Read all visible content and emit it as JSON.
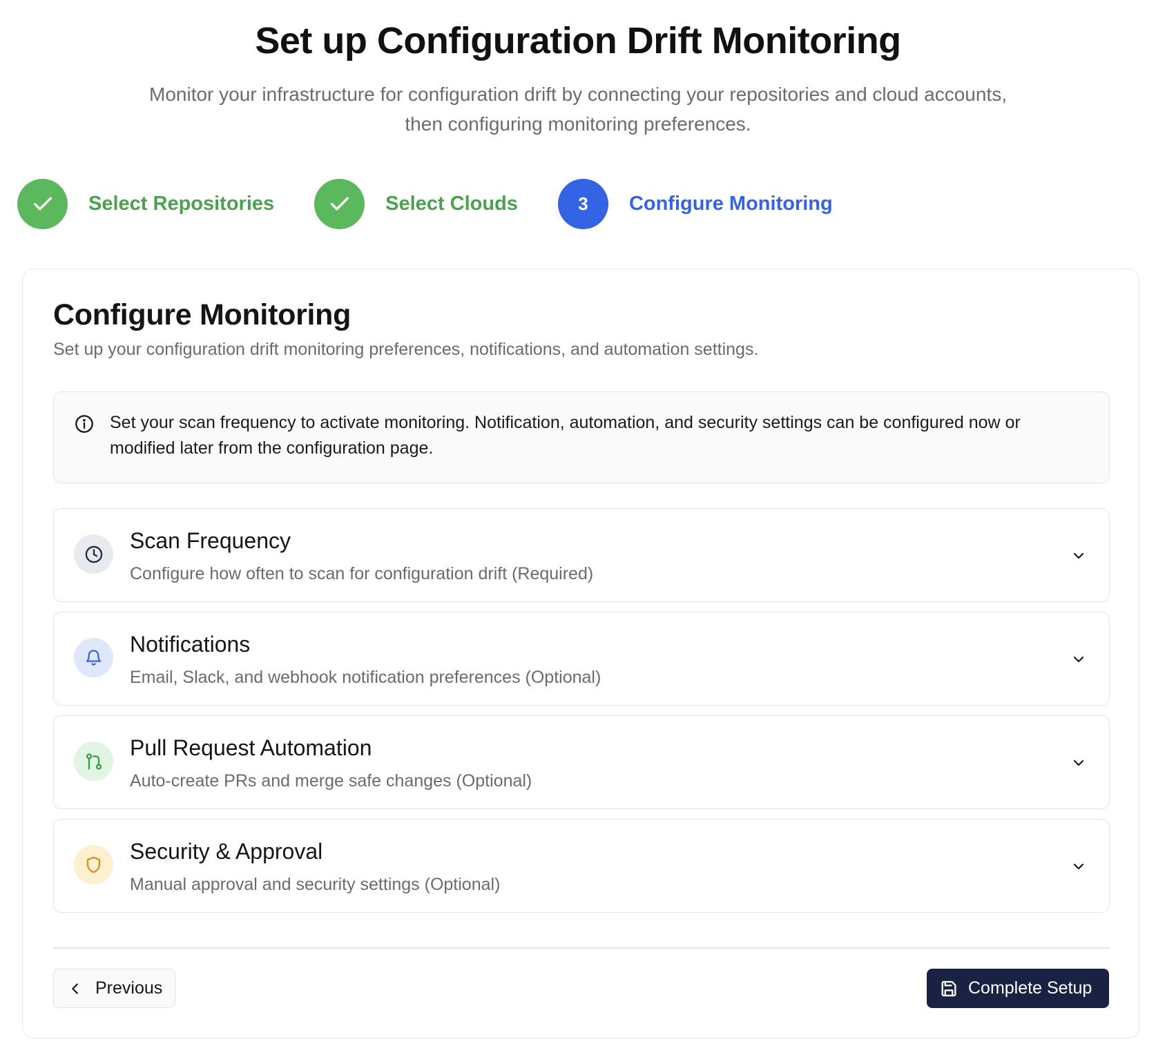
{
  "header": {
    "title": "Set up Configuration Drift Monitoring",
    "subtitle_line1": "Monitor your infrastructure for configuration drift by connecting your repositories and cloud accounts,",
    "subtitle_line2": "then configuring monitoring preferences."
  },
  "stepper": {
    "steps": [
      {
        "label": "Select Repositories",
        "status": "complete",
        "icon": "check-icon"
      },
      {
        "label": "Select Clouds",
        "status": "complete",
        "icon": "check-icon"
      },
      {
        "label": "Configure Monitoring",
        "status": "active",
        "number": "3"
      }
    ],
    "colors": {
      "complete": "#5cb85c",
      "active": "#3463e3"
    }
  },
  "card": {
    "title": "Configure Monitoring",
    "description": "Set up your configuration drift monitoring preferences, notifications, and automation settings.",
    "info": {
      "icon": "info-icon",
      "text": "Set your scan frequency to activate monitoring. Notification, automation, and security settings can be configured now or modified later from the configuration page."
    },
    "sections": [
      {
        "title": "Scan Frequency",
        "description": "Configure how often to scan for configuration drift (Required)",
        "icon": "clock-icon",
        "icon_bg": "#e8eaee",
        "icon_color": "#1f2a44"
      },
      {
        "title": "Notifications",
        "description": "Email, Slack, and webhook notification preferences (Optional)",
        "icon": "bell-icon",
        "icon_bg": "#dfe8fb",
        "icon_color": "#3463e3"
      },
      {
        "title": "Pull Request Automation",
        "description": "Auto-create PRs and merge safe changes (Optional)",
        "icon": "git-pull-request-icon",
        "icon_bg": "#e1f5e3",
        "icon_color": "#3e9a44"
      },
      {
        "title": "Security & Approval",
        "description": "Manual approval and security settings (Optional)",
        "icon": "shield-icon",
        "icon_bg": "#fdf0cf",
        "icon_color": "#d98b1c"
      }
    ]
  },
  "footer": {
    "previous_label": "Previous",
    "complete_label": "Complete Setup",
    "complete_bg": "#1a2244"
  }
}
